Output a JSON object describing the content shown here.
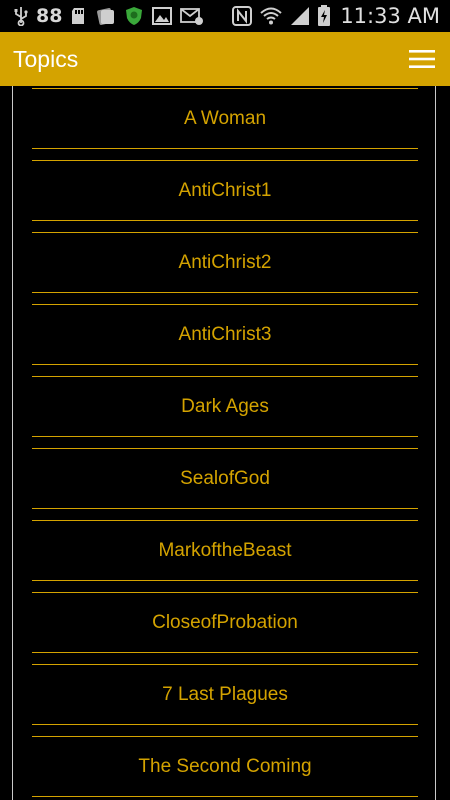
{
  "status_bar": {
    "notification_count": "88",
    "time": "11:33 AM",
    "icons": [
      "usb-icon",
      "sd-card-icon",
      "media-icon",
      "shield-app-icon",
      "image-icon",
      "email-icon",
      "nfc-icon",
      "wifi-icon",
      "signal-icon",
      "battery-charging-icon"
    ]
  },
  "app_bar": {
    "title": "Topics",
    "menu_icon": "hamburger-menu-icon"
  },
  "colors": {
    "accent": "#d4a300",
    "background": "#000000",
    "title_text": "#ffffff"
  },
  "topics": [
    {
      "label": "A Woman"
    },
    {
      "label": "AntiChrist1"
    },
    {
      "label": "AntiChrist2"
    },
    {
      "label": "AntiChrist3"
    },
    {
      "label": "Dark Ages"
    },
    {
      "label": "SealofGod"
    },
    {
      "label": "MarkoftheBeast"
    },
    {
      "label": "CloseofProbation"
    },
    {
      "label": "7 Last Plagues"
    },
    {
      "label": "The Second Coming"
    }
  ]
}
